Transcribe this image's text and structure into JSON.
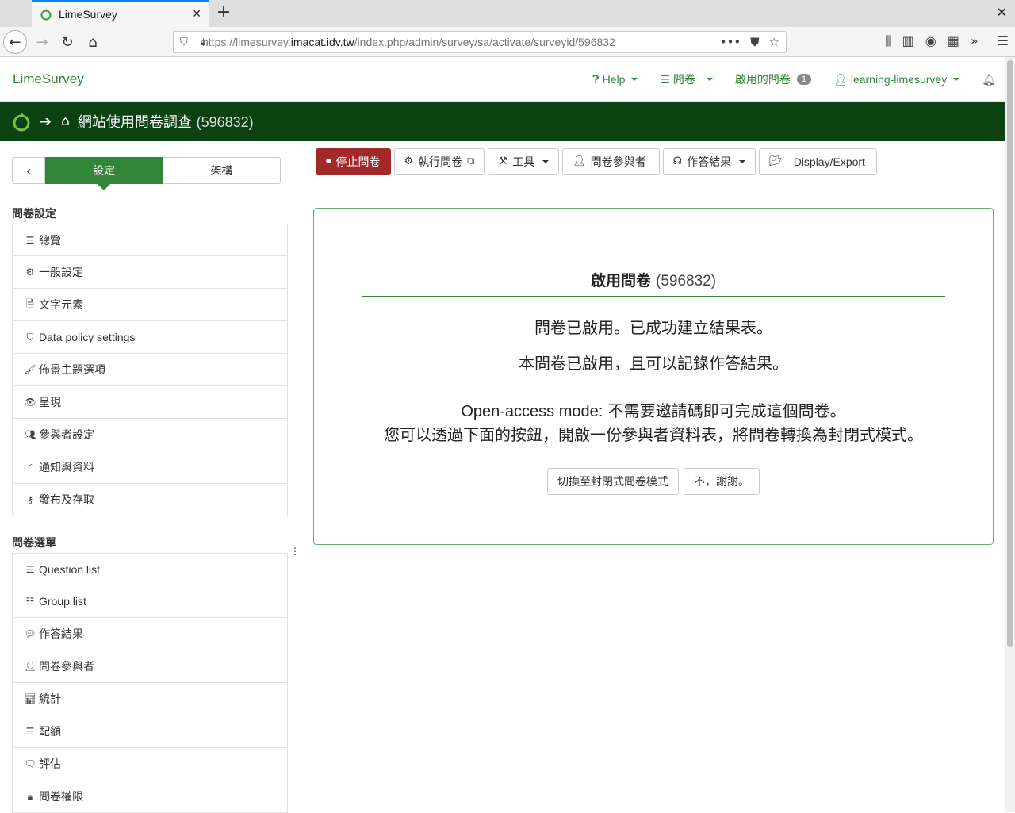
{
  "browser": {
    "tab_title": "LimeSurvey",
    "url_prefix": "https://limesurvey.",
    "url_domain": "imacat.idv.tw",
    "url_path": "/index.php/admin/survey/sa/activate/surveyid/596832"
  },
  "header": {
    "brand": "LimeSurvey",
    "help": "Help",
    "surveys": "問卷",
    "active_surveys": "啟用的問卷",
    "active_count": "1",
    "user": "learning-limesurvey"
  },
  "survey_bar": {
    "title": "網站使用問卷調查",
    "id": "(596832)"
  },
  "sidebar": {
    "tab_settings": "設定",
    "tab_structure": "架構",
    "section_settings": "問卷設定",
    "settings_items": [
      {
        "label": "總覽",
        "icon": "list-icon"
      },
      {
        "label": "一般設定",
        "icon": "cogs-icon"
      },
      {
        "label": "文字元素",
        "icon": "file-text-icon"
      },
      {
        "label": "Data policy settings",
        "icon": "shield-icon"
      },
      {
        "label": "佈景主題選項",
        "icon": "paint-brush-icon"
      },
      {
        "label": "呈現",
        "icon": "eye-slash-icon"
      },
      {
        "label": "參與者設定",
        "icon": "users-icon"
      },
      {
        "label": "通知與資料",
        "icon": "rss-icon"
      },
      {
        "label": "發布及存取",
        "icon": "key-icon"
      }
    ],
    "section_menu": "問卷選單",
    "menu_items": [
      {
        "label": "Question list",
        "icon": "list-icon"
      },
      {
        "label": "Group list",
        "icon": "th-list-icon"
      },
      {
        "label": "作答結果",
        "icon": "comment-icon"
      },
      {
        "label": "問卷參與者",
        "icon": "user-icon"
      },
      {
        "label": "統計",
        "icon": "bar-chart-icon"
      },
      {
        "label": "配額",
        "icon": "tasks-icon"
      },
      {
        "label": "評估",
        "icon": "comment-o-icon"
      },
      {
        "label": "問卷權限",
        "icon": "lock-icon"
      }
    ]
  },
  "toolbar": {
    "stop": "停止問卷",
    "run": "執行問卷",
    "tools": "工具",
    "participants": "問卷參與者",
    "responses": "作答結果",
    "display_export": "Display/Export"
  },
  "panel": {
    "title": "啟用問卷",
    "title_id": "(596832)",
    "line1": "問卷已啟用。已成功建立結果表。",
    "line2": "本問卷已啟用，且可以記錄作答結果。",
    "line3_en": "Open-access mode:",
    "line3_zh": " 不需要邀請碼即可完成這個問卷。",
    "line4": "您可以透過下面的按鈕，開啟一份參與者資料表，將問卷轉換為封閉式模式。",
    "btn_closed": "切換至封閉式問卷模式",
    "btn_no": "不，謝謝。"
  },
  "colors": {
    "brand_green": "#328637",
    "dark_green": "#0c4212",
    "danger": "#a3282a"
  }
}
